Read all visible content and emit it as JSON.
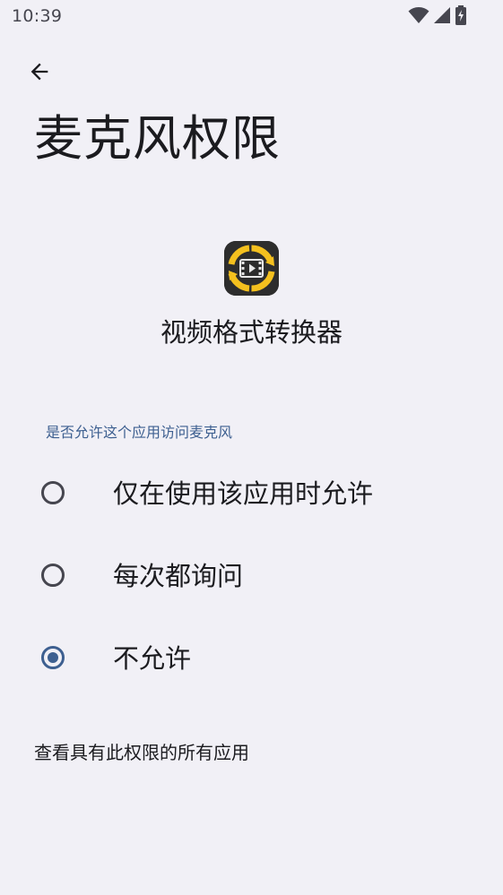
{
  "status_bar": {
    "time": "10:39",
    "icons": [
      "wifi-icon",
      "cell-signal-icon",
      "battery-charging-icon"
    ]
  },
  "header": {
    "back_icon": "arrow-left-icon",
    "title": "麦克风权限"
  },
  "app": {
    "icon": "video-converter-app-icon",
    "name": "视频格式转换器"
  },
  "permission": {
    "question": "是否允许这个应用访问麦克风",
    "options": [
      {
        "label": "仅在使用该应用时允许",
        "selected": false
      },
      {
        "label": "每次都询问",
        "selected": false
      },
      {
        "label": "不允许",
        "selected": true
      }
    ]
  },
  "footer": {
    "link": "查看具有此权限的所有应用"
  },
  "colors": {
    "background": "#f1f0f6",
    "accent": "#3d5f90",
    "text": "#1b1b1f",
    "icon_yellow": "#f4c01e"
  }
}
